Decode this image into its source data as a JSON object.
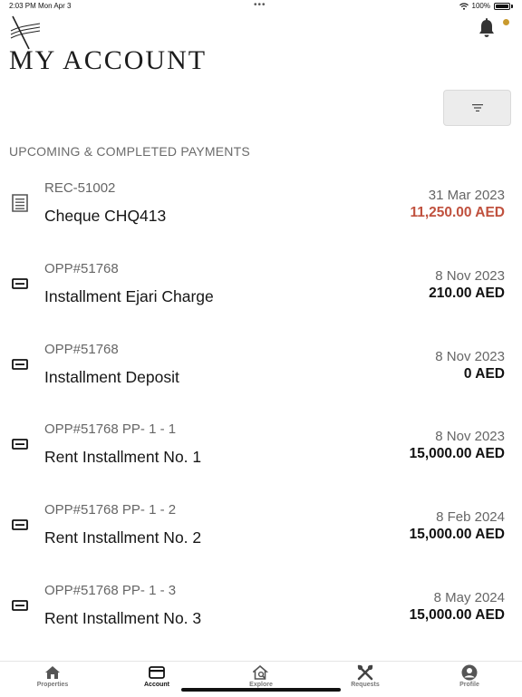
{
  "status_bar": {
    "time": "2:03 PM",
    "date": "Mon Apr 3",
    "battery": "100%"
  },
  "header": {
    "title": "MY ACCOUNT"
  },
  "section": {
    "title": "UPCOMING & COMPLETED PAYMENTS"
  },
  "payments": [
    {
      "ref": "REC-51002",
      "description": "Cheque CHQ413",
      "date": "31 Mar 2023",
      "amount": "11,250.00 AED",
      "icon": "receipt-icon",
      "amount_color": "#c0513e"
    },
    {
      "ref": "OPP#51768",
      "description": "Installment Ejari Charge",
      "date": "8 Nov 2023",
      "amount": "210.00 AED",
      "icon": "payment-card-icon"
    },
    {
      "ref": "OPP#51768",
      "description": "Installment Deposit",
      "date": "8 Nov 2023",
      "amount": "0 AED",
      "icon": "payment-card-icon"
    },
    {
      "ref": "OPP#51768 PP- 1 - 1",
      "description": "Rent Installment No.  1",
      "date": "8 Nov 2023",
      "amount": "15,000.00 AED",
      "icon": "payment-card-icon"
    },
    {
      "ref": "OPP#51768 PP- 1 - 2",
      "description": "Rent Installment No.  2",
      "date": "8 Feb 2024",
      "amount": "15,000.00 AED",
      "icon": "payment-card-icon"
    },
    {
      "ref": "OPP#51768 PP- 1 - 3",
      "description": "Rent Installment No.  3",
      "date": "8 May 2024",
      "amount": "15,000.00 AED",
      "icon": "payment-card-icon"
    }
  ],
  "tabs": [
    {
      "label": "Properties",
      "icon": "home-icon",
      "active": false
    },
    {
      "label": "Account",
      "icon": "card-icon",
      "active": true
    },
    {
      "label": "Explore",
      "icon": "explore-icon",
      "active": false
    },
    {
      "label": "Requests",
      "icon": "tools-icon",
      "active": false
    },
    {
      "label": "Profile",
      "icon": "profile-icon",
      "active": false
    }
  ],
  "colors": {
    "accent": "#c99a2e",
    "negative_amount": "#c0513e"
  }
}
